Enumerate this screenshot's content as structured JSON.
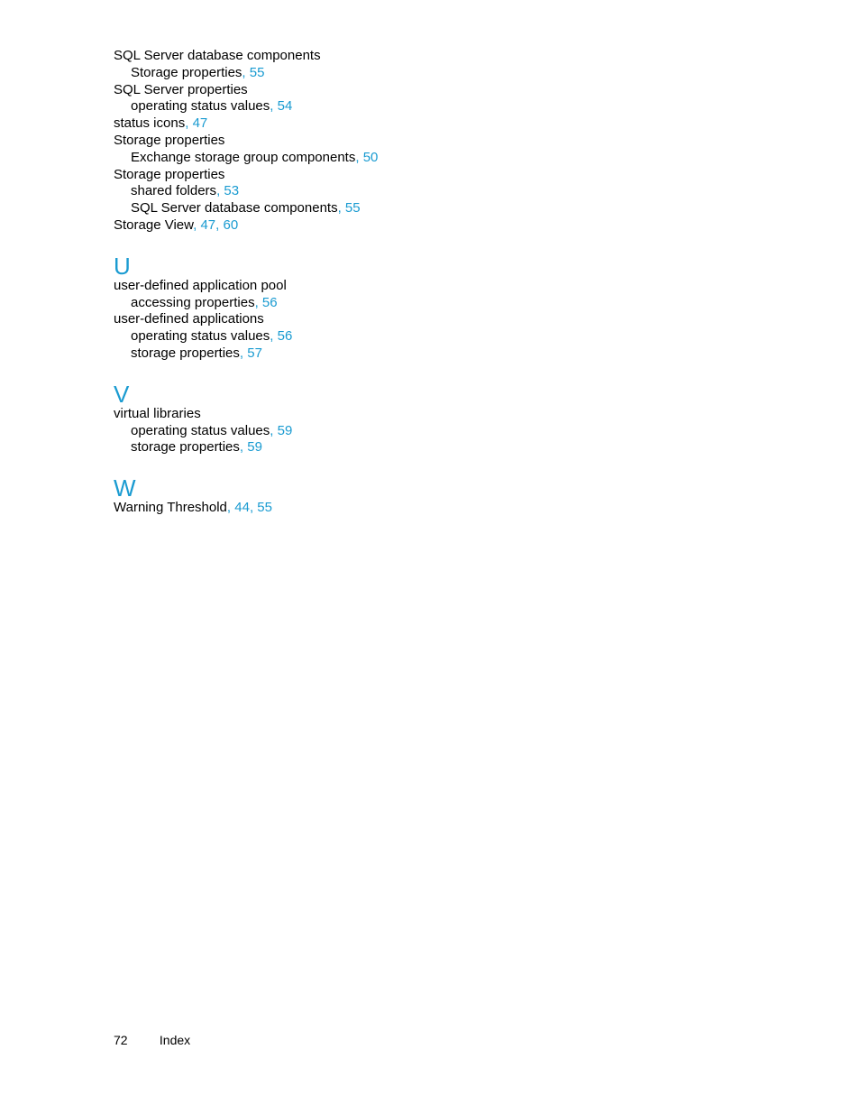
{
  "index": {
    "continued_entries": [
      {
        "text": "SQL Server database components",
        "level": 0,
        "pages": []
      },
      {
        "text": "Storage properties",
        "level": 1,
        "pages": [
          "55"
        ]
      },
      {
        "text": "SQL Server properties",
        "level": 0,
        "pages": []
      },
      {
        "text": "operating status values",
        "level": 1,
        "pages": [
          "54"
        ]
      },
      {
        "text": "status icons",
        "level": 0,
        "pages": [
          "47"
        ]
      },
      {
        "text": "Storage properties",
        "level": 0,
        "pages": []
      },
      {
        "text": "Exchange storage group components",
        "level": 1,
        "pages": [
          "50"
        ]
      },
      {
        "text": "Storage properties",
        "level": 0,
        "pages": []
      },
      {
        "text": "shared folders",
        "level": 1,
        "pages": [
          "53"
        ]
      },
      {
        "text": "SQL Server database components",
        "level": 1,
        "pages": [
          "55"
        ]
      },
      {
        "text": "Storage View",
        "level": 0,
        "pages": [
          "47",
          "60"
        ]
      }
    ],
    "sections": [
      {
        "letter": "U",
        "entries": [
          {
            "text": "user-defined application pool",
            "level": 0,
            "pages": []
          },
          {
            "text": "accessing properties",
            "level": 1,
            "pages": [
              "56"
            ]
          },
          {
            "text": "user-defined applications",
            "level": 0,
            "pages": []
          },
          {
            "text": "operating status values",
            "level": 1,
            "pages": [
              "56"
            ]
          },
          {
            "text": "storage properties",
            "level": 1,
            "pages": [
              "57"
            ]
          }
        ]
      },
      {
        "letter": "V",
        "entries": [
          {
            "text": "virtual libraries",
            "level": 0,
            "pages": []
          },
          {
            "text": "operating status values",
            "level": 1,
            "pages": [
              "59"
            ]
          },
          {
            "text": "storage properties",
            "level": 1,
            "pages": [
              "59"
            ]
          }
        ]
      },
      {
        "letter": "W",
        "entries": [
          {
            "text": "Warning Threshold",
            "level": 0,
            "pages": [
              "44",
              "55"
            ]
          }
        ]
      }
    ]
  },
  "footer": {
    "page_number": "72",
    "section_title": "Index"
  },
  "colors": {
    "link": "#1a9bd1",
    "text": "#000000"
  }
}
